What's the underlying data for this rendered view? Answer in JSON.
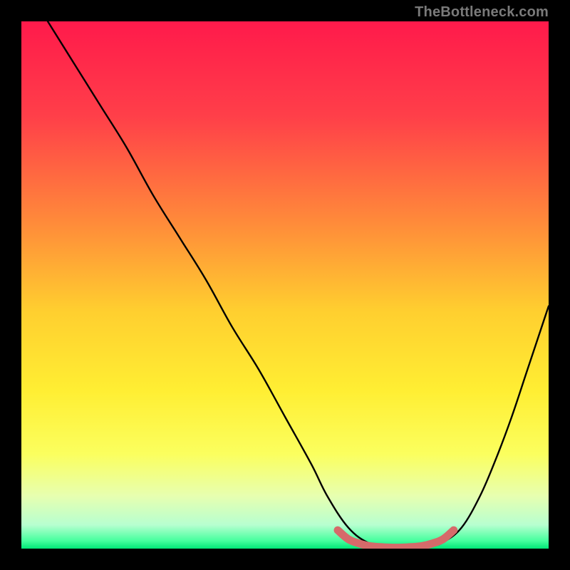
{
  "watermark": "TheBottleneck.com",
  "gradient_stops": [
    {
      "offset": 0.0,
      "color": "#ff1a4b"
    },
    {
      "offset": 0.18,
      "color": "#ff3f49"
    },
    {
      "offset": 0.38,
      "color": "#ff8a3a"
    },
    {
      "offset": 0.55,
      "color": "#ffcf2f"
    },
    {
      "offset": 0.7,
      "color": "#ffee33"
    },
    {
      "offset": 0.82,
      "color": "#fbff5e"
    },
    {
      "offset": 0.9,
      "color": "#e7ffb0"
    },
    {
      "offset": 0.955,
      "color": "#b7ffd0"
    },
    {
      "offset": 0.985,
      "color": "#46ff9e"
    },
    {
      "offset": 1.0,
      "color": "#00e676"
    }
  ],
  "chart_data": {
    "type": "line",
    "title": "",
    "xlabel": "",
    "ylabel": "",
    "xlim": [
      0,
      100
    ],
    "ylim": [
      0,
      100
    ],
    "series": [
      {
        "name": "bottleneck-curve",
        "color": "#000000",
        "x": [
          5,
          10,
          15,
          20,
          25,
          30,
          35,
          40,
          45,
          50,
          55,
          58,
          62,
          66,
          70,
          74,
          78,
          80,
          83.5,
          87,
          90,
          93,
          96,
          100
        ],
        "values": [
          100,
          92,
          84,
          76,
          67,
          59,
          51,
          42,
          34,
          25,
          16,
          10,
          4,
          1,
          0.3,
          0.2,
          0.6,
          1.2,
          4,
          10,
          17,
          25,
          34,
          46
        ]
      }
    ],
    "markers": [
      {
        "name": "flat-bottom-band",
        "color": "#d66a6a",
        "x": [
          60,
          62,
          64,
          66,
          68,
          70,
          72,
          74,
          76,
          78,
          80,
          82
        ],
        "values": [
          3.5,
          1.8,
          1.0,
          0.5,
          0.3,
          0.2,
          0.2,
          0.3,
          0.5,
          1.0,
          1.8,
          3.5
        ],
        "radius": 5
      }
    ]
  }
}
